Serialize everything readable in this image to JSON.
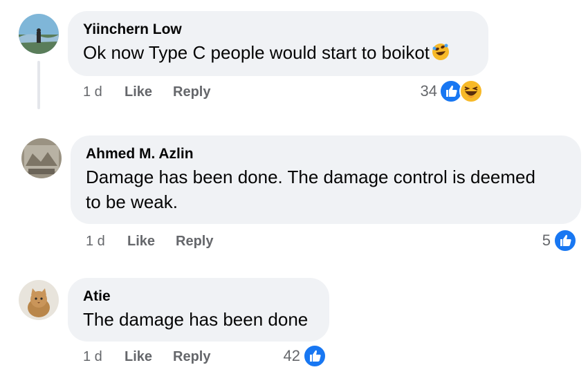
{
  "comments": [
    {
      "author": "Yiinchern Low",
      "text": "Ok now Type C people would start to boikot",
      "time": "1 d",
      "like": "Like",
      "reply": "Reply",
      "reaction_count": "34",
      "reactions": [
        "like-icon",
        "laughing-emoji-icon"
      ]
    },
    {
      "author": "Ahmed M. Azlin",
      "text_line1": "Damage has been done. The damage control is deemed",
      "text_line2": "to be weak.",
      "time": "1 d",
      "like": "Like",
      "reply": "Reply",
      "reaction_count": "5",
      "reactions": [
        "like-icon"
      ]
    },
    {
      "author": "Atie",
      "text": "The damage has been done",
      "time": "1 d",
      "like": "Like",
      "reply": "Reply",
      "reaction_count": "42",
      "reactions": [
        "like-icon"
      ]
    }
  ],
  "colors": {
    "bubble": "#f0f2f5",
    "meta": "#65676b",
    "like_blue": "#1877f2",
    "laugh_yellow": "#f7b928"
  }
}
